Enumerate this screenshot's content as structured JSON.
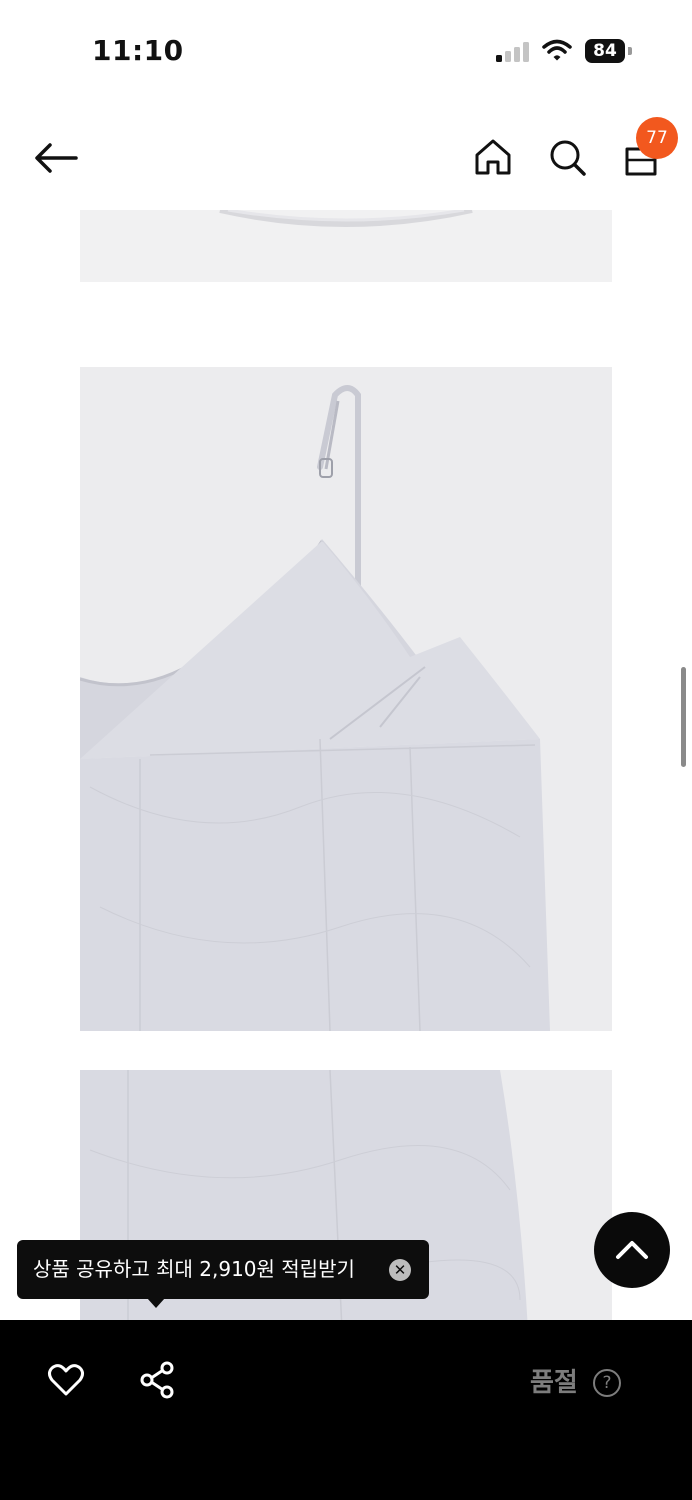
{
  "status_bar": {
    "time": "11:10",
    "battery": "84"
  },
  "nav": {
    "cart_count": "77"
  },
  "tooltip": {
    "text": "상품 공유하고 최대 2,910원 적립받기",
    "close_symbol": "✕"
  },
  "bottom_bar": {
    "soldout_label": "품절",
    "help_symbol": "?"
  },
  "icons": {
    "back": "back-arrow-icon",
    "home": "home-icon",
    "search": "search-icon",
    "cart": "shopping-bag-icon",
    "top": "chevron-up-icon",
    "wishlist": "heart-icon",
    "share": "share-icon"
  },
  "colors": {
    "badge": "#f2581e",
    "bottom_bar": "#000000",
    "image_background": "#ececee",
    "soldout_text": "#7d7d7d"
  }
}
